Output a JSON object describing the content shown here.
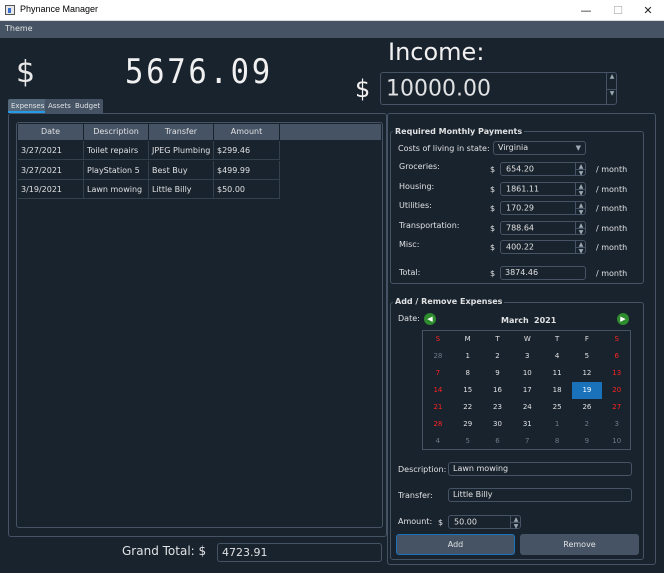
{
  "window": {
    "title": "Phynance Manager",
    "minimize": "—",
    "maximize": "☐",
    "close": "✕"
  },
  "menubar": {
    "theme": "Theme"
  },
  "summary": {
    "currency_symbol": "$",
    "balance": "5676.09",
    "income_label": "Income:",
    "income_value": "10000.00"
  },
  "tabs": [
    "Expenses",
    "Assets",
    "Budget"
  ],
  "expenses_table": {
    "columns": [
      "Date",
      "Description",
      "Transfer",
      "Amount"
    ],
    "rows": [
      [
        "3/27/2021",
        "Toilet repairs",
        "JPEG Plumbing",
        "$299.46"
      ],
      [
        "3/27/2021",
        "PlayStation 5",
        "Best Buy",
        "$499.99"
      ],
      [
        "3/19/2021",
        "Lawn mowing",
        "Little Billy",
        "$50.00"
      ]
    ]
  },
  "grand_total": {
    "label": "Grand Total: $",
    "value": "4723.91"
  },
  "monthly": {
    "title": "Required Monthly Payments",
    "state_label": "Costs of living in state:",
    "state_value": "Virginia",
    "per_month": "/ month",
    "dollar": "$",
    "items": [
      {
        "label": "Groceries:",
        "value": "654.20"
      },
      {
        "label": "Housing:",
        "value": "1861.11"
      },
      {
        "label": "Utilities:",
        "value": "170.29"
      },
      {
        "label": "Transportation:",
        "value": "788.64"
      },
      {
        "label": "Misc:",
        "value": "400.22"
      }
    ],
    "total_label": "Total:",
    "total_value": "3874.46"
  },
  "add_remove": {
    "title": "Add / Remove Expenses",
    "date_label": "Date:",
    "month": "March",
    "year": "2021",
    "weekdays": [
      "S",
      "M",
      "T",
      "W",
      "T",
      "F",
      "S"
    ],
    "weeks": [
      [
        "28",
        "1",
        "2",
        "3",
        "4",
        "5",
        "6"
      ],
      [
        "7",
        "8",
        "9",
        "10",
        "11",
        "12",
        "13"
      ],
      [
        "14",
        "15",
        "16",
        "17",
        "18",
        "19",
        "20"
      ],
      [
        "21",
        "22",
        "23",
        "24",
        "25",
        "26",
        "27"
      ],
      [
        "28",
        "29",
        "30",
        "31",
        "1",
        "2",
        "3"
      ],
      [
        "4",
        "5",
        "6",
        "7",
        "8",
        "9",
        "10"
      ]
    ],
    "selected_day": "19",
    "description_label": "Description:",
    "description_value": "Lawn mowing",
    "transfer_label": "Transfer:",
    "transfer_value": "Little Billy",
    "amount_label": "Amount:",
    "amount_dollar": "$",
    "amount_value": "50.00",
    "add_button": "Add",
    "remove_button": "Remove"
  },
  "colors": {
    "background": "#19232d",
    "panel": "#455364",
    "accent": "#1a72bb",
    "weekend": "#ff2222",
    "nav_arrow": "#3fbf3f"
  }
}
